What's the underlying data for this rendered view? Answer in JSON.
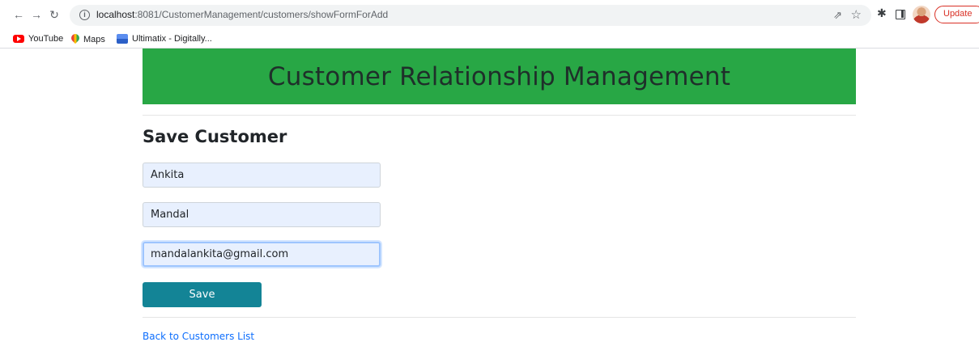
{
  "browser": {
    "url_host": "localhost",
    "url_path": ":8081/CustomerManagement/customers/showFormForAdd",
    "update_label": "Update",
    "bookmarks": [
      {
        "label": "YouTube",
        "icon": "youtube-icon"
      },
      {
        "label": "Maps",
        "icon": "maps-icon"
      },
      {
        "label": "Ultimatix - Digitally...",
        "icon": "ultimatix-icon"
      }
    ]
  },
  "header": {
    "title": "Customer Relationship Management",
    "color": "#28a745"
  },
  "form": {
    "title": "Save Customer",
    "first_name": "Ankita",
    "last_name": "Mandal",
    "email": "mandalankita@gmail.com",
    "save_label": "Save",
    "save_color": "#138496"
  },
  "footer": {
    "back_link": "Back to Customers List"
  }
}
